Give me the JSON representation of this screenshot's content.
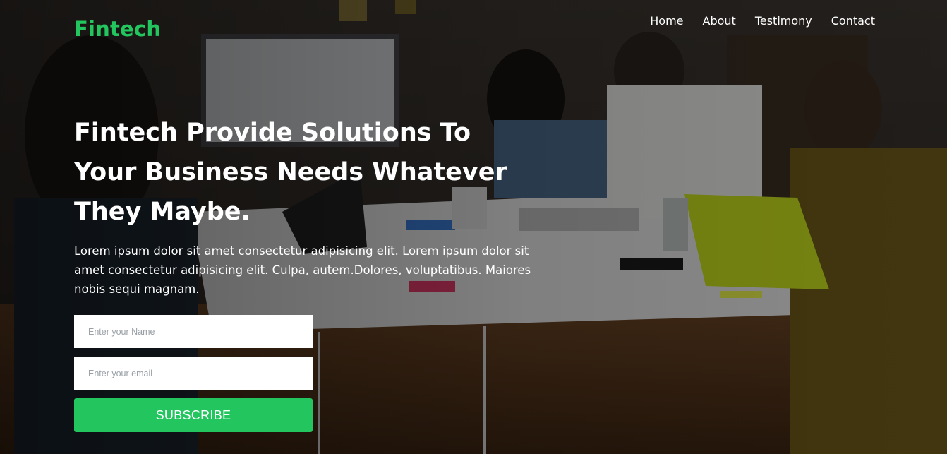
{
  "brand": {
    "name": "Fintech",
    "color": "#22c55e"
  },
  "nav": {
    "items": [
      {
        "label": "Home"
      },
      {
        "label": "About"
      },
      {
        "label": "Testimony"
      },
      {
        "label": "Contact"
      }
    ]
  },
  "hero": {
    "title": "Fintech Provide Solutions To Your Business Needs Whatever They Maybe.",
    "description": "Lorem ipsum dolor sit amet consectetur adipisicing elit. Lorem ipsum dolor sit amet consectetur adipisicing elit. Culpa, autem.Dolores, voluptatibus. Maiores nobis sequi magnam."
  },
  "subscribe_form": {
    "name_placeholder": "Enter your Name",
    "email_placeholder": "Enter your email",
    "button_label": "SUBSCRIBE",
    "button_color": "#22c55e"
  }
}
